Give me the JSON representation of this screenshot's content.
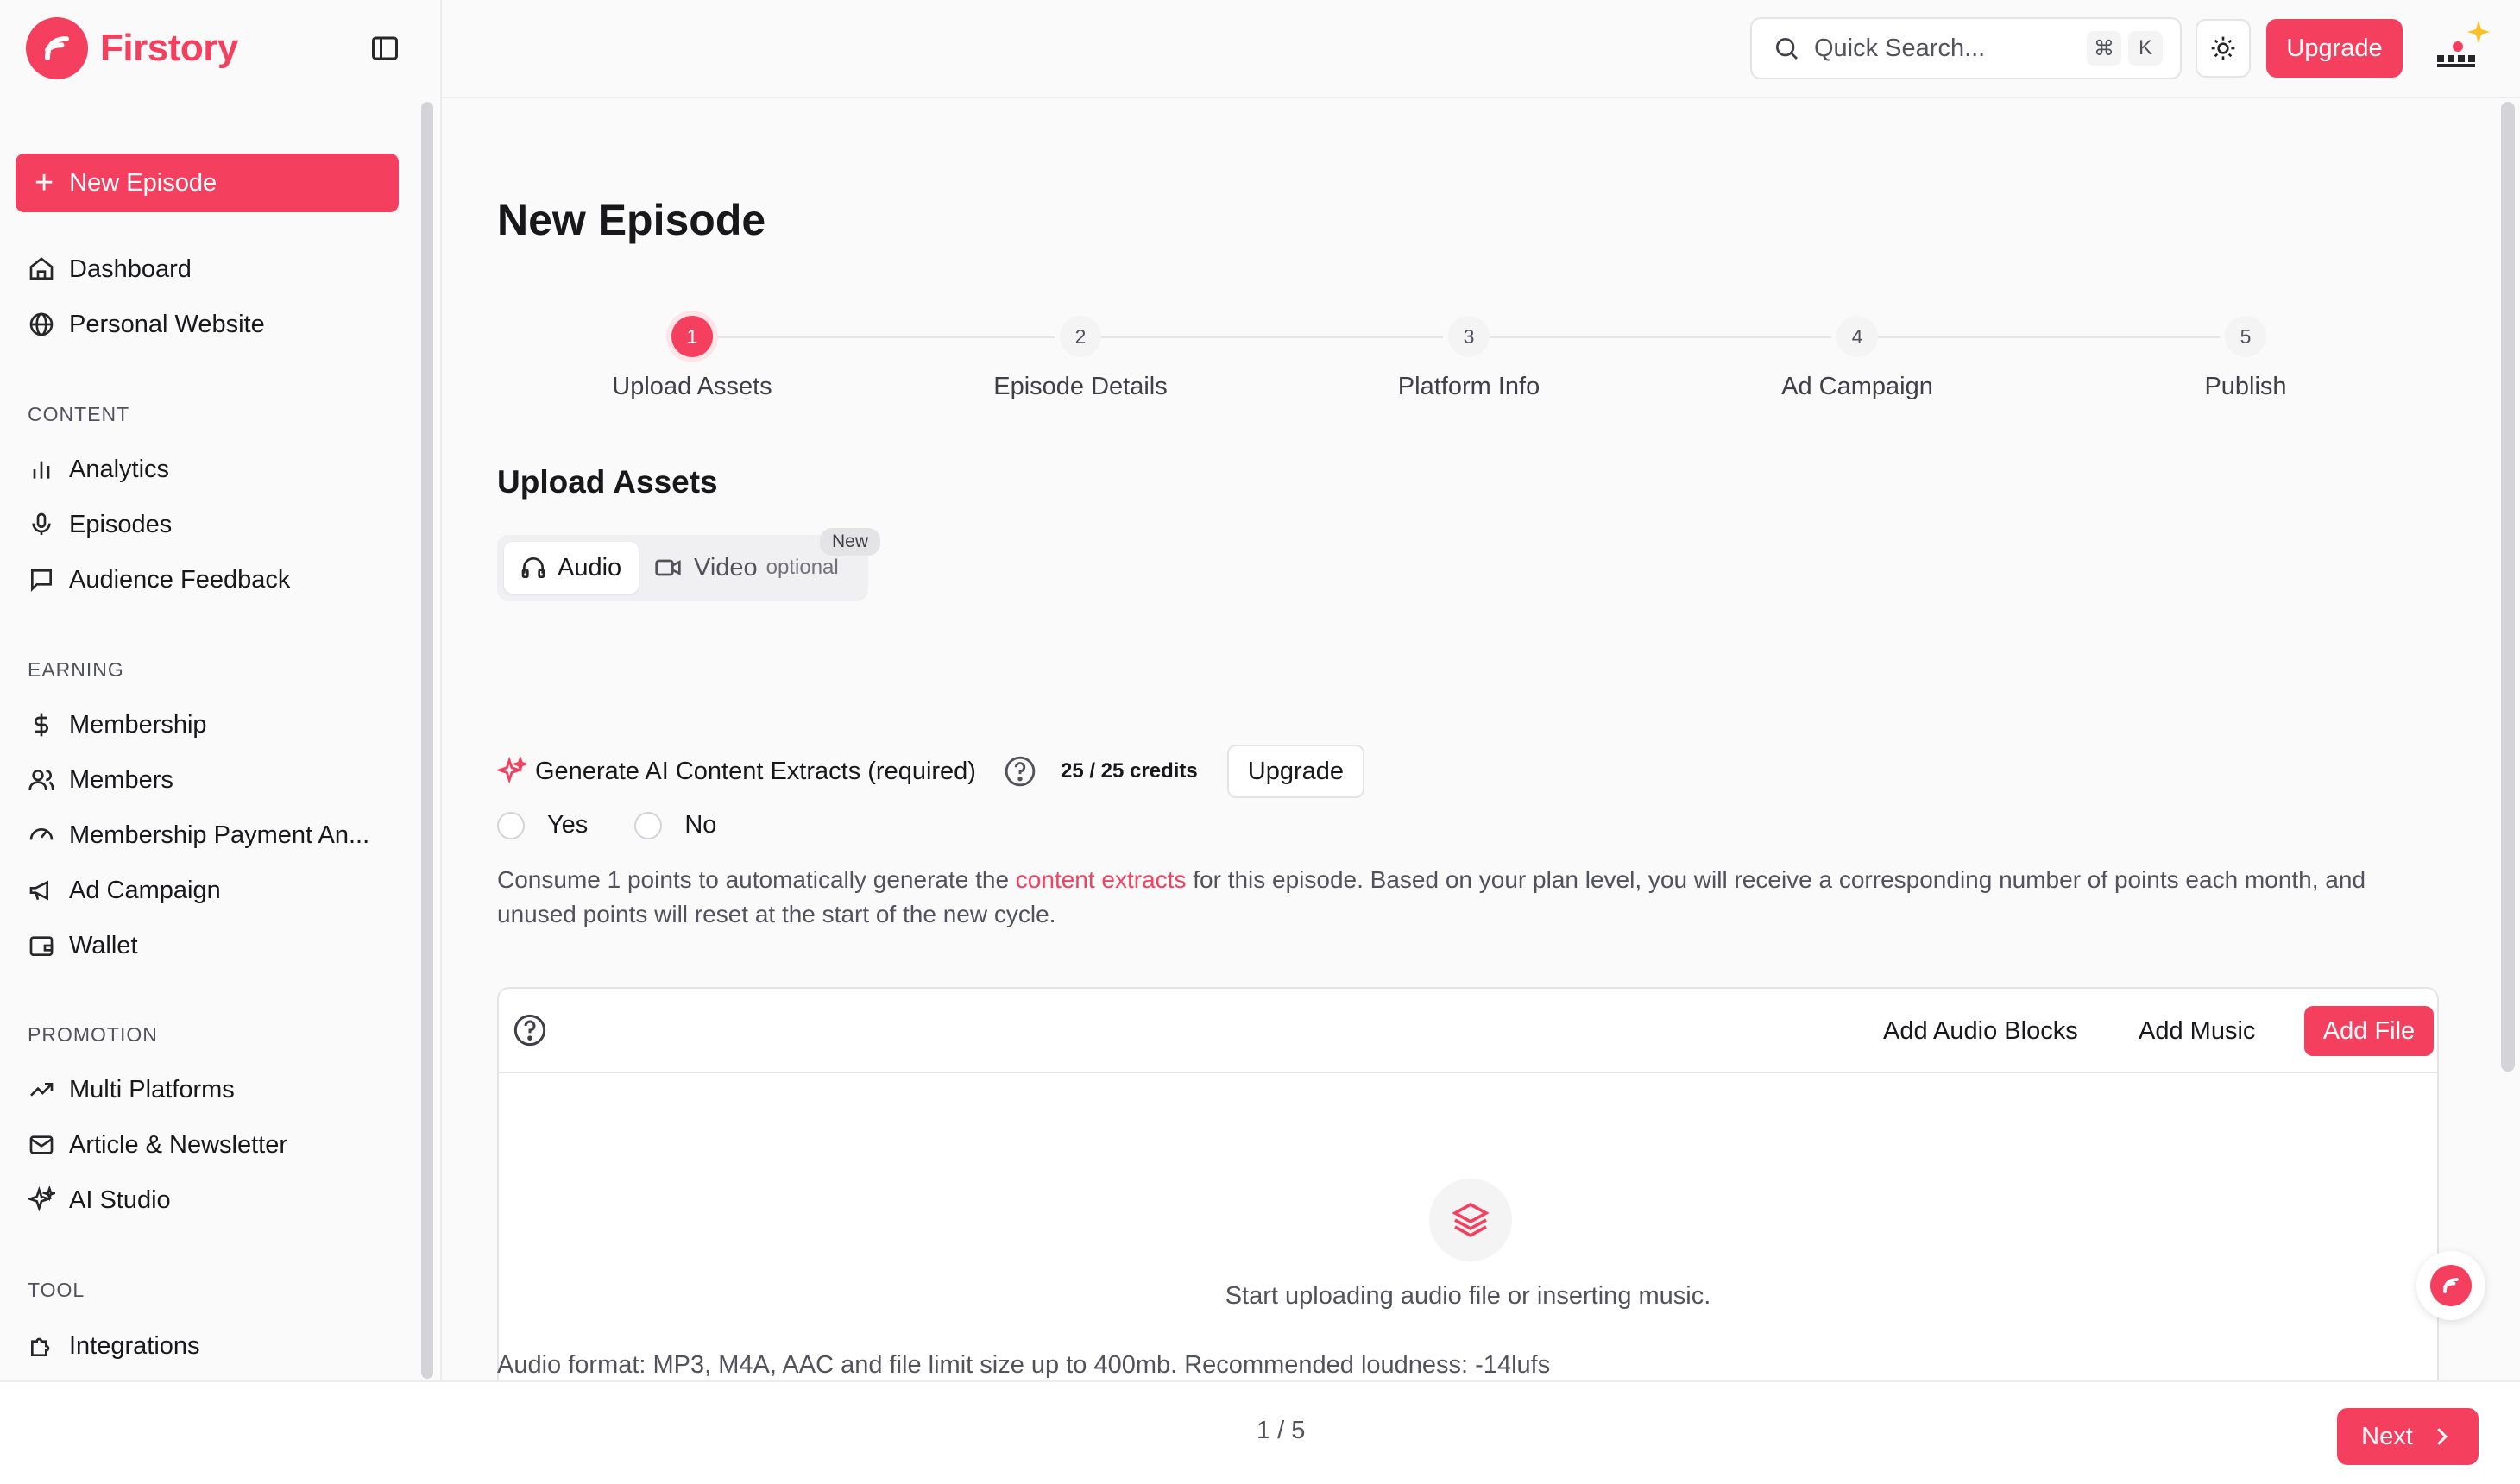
{
  "brand": {
    "name": "Firstory",
    "accent": "#f43f5e"
  },
  "sidebar": {
    "new_episode": "New Episode",
    "top_items": [
      {
        "label": "Dashboard",
        "icon": "home-icon"
      },
      {
        "label": "Personal Website",
        "icon": "globe-icon"
      }
    ],
    "sections": [
      {
        "label": "CONTENT",
        "items": [
          {
            "label": "Analytics",
            "icon": "bar-chart-icon"
          },
          {
            "label": "Episodes",
            "icon": "microphone-icon"
          },
          {
            "label": "Audience Feedback",
            "icon": "message-square-icon"
          }
        ]
      },
      {
        "label": "EARNING",
        "items": [
          {
            "label": "Membership",
            "icon": "dollar-icon"
          },
          {
            "label": "Members",
            "icon": "users-icon"
          },
          {
            "label": "Membership Payment An...",
            "icon": "gauge-icon"
          },
          {
            "label": "Ad Campaign",
            "icon": "megaphone-icon"
          },
          {
            "label": "Wallet",
            "icon": "wallet-icon"
          }
        ]
      },
      {
        "label": "PROMOTION",
        "items": [
          {
            "label": "Multi Platforms",
            "icon": "trending-up-icon"
          },
          {
            "label": "Article & Newsletter",
            "icon": "mail-icon"
          },
          {
            "label": "AI Studio",
            "icon": "sparkles-icon"
          }
        ]
      },
      {
        "label": "TOOL",
        "items": [
          {
            "label": "Integrations",
            "icon": "puzzle-icon"
          }
        ]
      }
    ]
  },
  "topbar": {
    "search_placeholder": "Quick Search...",
    "shortcut_cmd": "⌘",
    "shortcut_key": "K",
    "upgrade": "Upgrade"
  },
  "page": {
    "title": "New Episode",
    "steps": [
      {
        "num": "1",
        "label": "Upload Assets",
        "active": true
      },
      {
        "num": "2",
        "label": "Episode Details",
        "active": false
      },
      {
        "num": "3",
        "label": "Platform Info",
        "active": false
      },
      {
        "num": "4",
        "label": "Ad Campaign",
        "active": false
      },
      {
        "num": "5",
        "label": "Publish",
        "active": false
      }
    ],
    "section_title": "Upload Assets",
    "tabs": {
      "audio": "Audio",
      "video": "Video",
      "video_optional": "optional",
      "new_badge": "New"
    },
    "ai": {
      "label": "Generate AI Content Extracts (required)",
      "credits": "25 / 25 credits",
      "upgrade": "Upgrade",
      "yes": "Yes",
      "no": "No"
    },
    "description": {
      "before": "Consume 1 points to automatically generate the ",
      "link": "content extracts",
      "after": " for this episode. Based on your plan level, you will receive a corresponding number of points each month, and unused points will reset at the start of the new cycle."
    },
    "upload": {
      "add_audio_blocks": "Add Audio Blocks",
      "add_music": "Add Music",
      "add_file": "Add File",
      "empty_text": "Start uploading audio file or inserting music."
    },
    "format_note": "Audio format: MP3, M4A, AAC and file limit size up to 400mb. Recommended loudness: -14lufs"
  },
  "footer": {
    "pager": "1 / 5",
    "next": "Next"
  }
}
